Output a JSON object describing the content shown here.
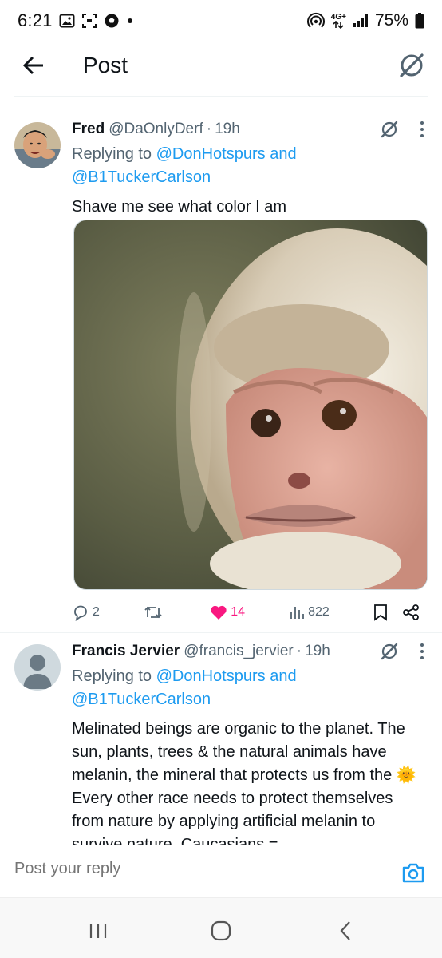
{
  "status_bar": {
    "time": "6:21",
    "network": "4G+",
    "battery": "75%"
  },
  "app_bar": {
    "title": "Post"
  },
  "posts": [
    {
      "display_name": "Fred",
      "handle": "@DaOnlyDerf",
      "time": "19h",
      "replying_prefix": "Replying to",
      "mention_1": "@DonHotspurs",
      "and": "and",
      "mention_2": "@B1TuckerCarlson",
      "text": "Shave me see what color I am",
      "stats": {
        "replies": "2",
        "reposts": "",
        "likes": "14",
        "views": "822"
      },
      "liked": true
    },
    {
      "display_name": "Francis Jervier",
      "handle": "@francis_jervier",
      "time": "19h",
      "replying_prefix": "Replying to",
      "mention_1": "@DonHotspurs",
      "and": "and",
      "mention_2": "@B1TuckerCarlson",
      "text_part1": "Melinated beings are organic to the planet. The sun, plants, trees & the natural animals have melanin, the mineral that protects us from the",
      "emoji": "🌞",
      "text_part2": "Every other race needs to protect themselves from nature by applying artificial melanin to survive nature. Caucasians ="
    }
  ],
  "composer": {
    "placeholder": "Post your reply"
  },
  "colors": {
    "link": "#1d9bf0",
    "secondary_text": "#536471",
    "like": "#f91880"
  }
}
